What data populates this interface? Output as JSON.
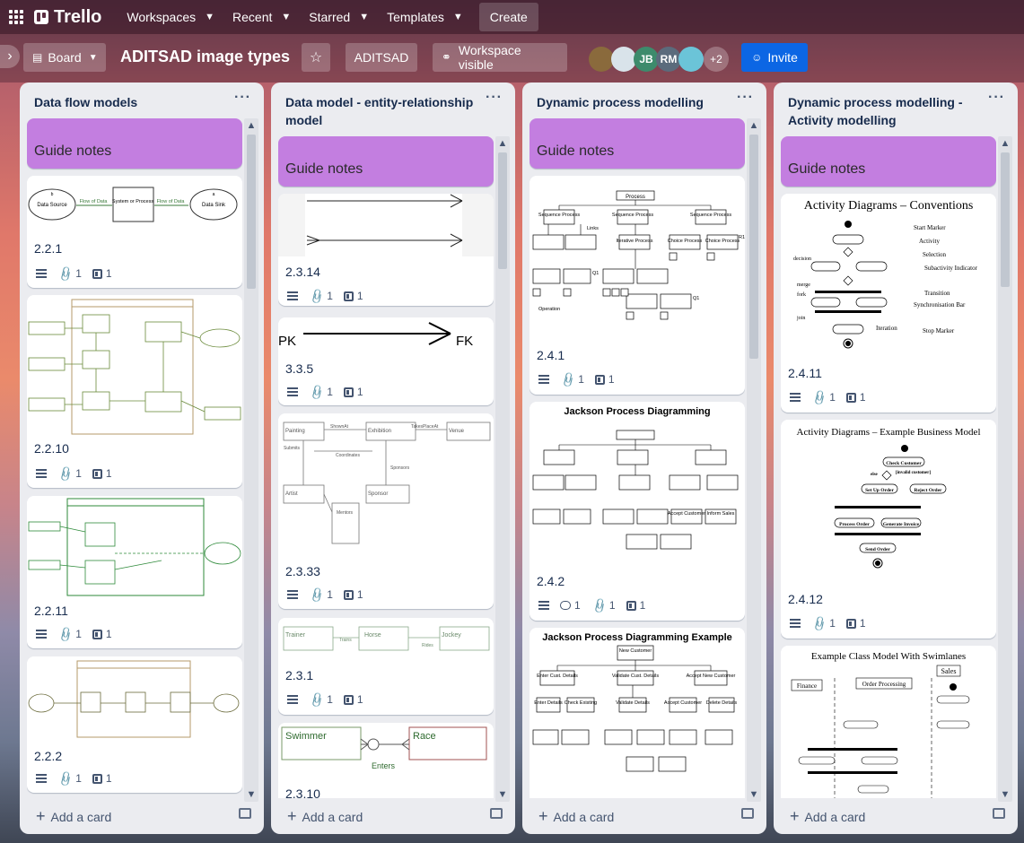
{
  "topbar": {
    "app_name": "Trello",
    "nav": [
      "Workspaces",
      "Recent",
      "Starred",
      "Templates"
    ],
    "create": "Create"
  },
  "board": {
    "view": "Board",
    "title": "ADITSAD image types",
    "workspace": "ADITSAD",
    "visibility": "Workspace visible",
    "avatars": [
      "JB",
      "RM"
    ],
    "more_members": "+2",
    "invite": "Invite"
  },
  "lists": [
    {
      "title": "Data flow models",
      "guide": "Guide notes",
      "cards": [
        {
          "title": "2.2.1",
          "attachments": "1",
          "checklist": "1"
        },
        {
          "title": "2.2.10",
          "attachments": "1",
          "checklist": "1"
        },
        {
          "title": "2.2.11",
          "attachments": "1",
          "checklist": "1"
        },
        {
          "title": "2.2.2",
          "attachments": "1",
          "checklist": "1"
        }
      ],
      "add_card": "Add a card"
    },
    {
      "title": "Data model - entity-relationship model",
      "guide": "Guide notes",
      "cards": [
        {
          "title": "2.3.14",
          "attachments": "1",
          "checklist": "1"
        },
        {
          "title": "3.3.5",
          "attachments": "1",
          "checklist": "1"
        },
        {
          "title": "2.3.33",
          "attachments": "1",
          "checklist": "1"
        },
        {
          "title": "2.3.1",
          "attachments": "1",
          "checklist": "1"
        },
        {
          "title": "2.3.10"
        }
      ],
      "add_card": "Add a card"
    },
    {
      "title": "Dynamic process modelling",
      "guide": "Guide notes",
      "cards": [
        {
          "title": "2.4.1",
          "attachments": "1",
          "checklist": "1"
        },
        {
          "title": "2.4.2",
          "comments": "1",
          "attachments": "1",
          "checklist": "1"
        },
        {
          "title": ""
        }
      ],
      "add_card": "Add a card"
    },
    {
      "title": "Dynamic process modelling - Activity modelling",
      "guide": "Guide notes",
      "cards": [
        {
          "title": "2.4.11",
          "attachments": "1",
          "checklist": "1"
        },
        {
          "title": "2.4.12",
          "attachments": "1",
          "checklist": "1"
        },
        {
          "title": ""
        }
      ],
      "add_card": "Add a card"
    }
  ],
  "covers": {
    "dfd1": {
      "source": "Data Source",
      "flow1": "Flow of Data",
      "process": "System or Process",
      "flow2": "Flow of Data",
      "sink": "Data Sink",
      "b": "b",
      "a": "a"
    },
    "er_pkfk": {
      "pk": "PK",
      "fk": "FK"
    },
    "er_painting": {
      "painting": "Painting",
      "shownat": "ShownAt",
      "exhibition": "Exhibition",
      "takesplaceat": "TakesPlaceAt",
      "venue": "Venue",
      "submits": "Submits",
      "coordinates": "Coordinates",
      "sponsors": "Sponsors",
      "artist": "Artist",
      "sponsor": "Sponsor",
      "mentors": "Mentors"
    },
    "er_trainer": {
      "trainer": "Trainer",
      "trains": "Trains",
      "horse": "Horse",
      "rides": "Rides",
      "jockey": "Jockey"
    },
    "er_swimmer": {
      "swimmer": "Swimmer",
      "race": "Race",
      "enters": "Enters"
    },
    "jsp1": {
      "process": "Process",
      "seq": "Sequence Process",
      "links": "Links",
      "iter": "Iterative Process",
      "choice": "Choice Process",
      "operation": "Operation",
      "r1": "R1",
      "q1": "Q1"
    },
    "jsp2": {
      "title": "Jackson Process Diagramming",
      "accept": "Accept Customer",
      "inform": "Inform Sales"
    },
    "jsp3": {
      "title": "Jackson Process Diagramming Example",
      "root": "New Customer",
      "enter": "Enter Cust. Details",
      "validate": "Validate Cust. Details",
      "accept": "Accept New Customer",
      "enterd": "Enter Details",
      "check": "Check Existing",
      "validated": "Validate Details",
      "acceptc": "Accept Customer",
      "delete": "Delete Details"
    },
    "act1": {
      "title": "Activity Diagrams – Conventions",
      "start": "Start Marker",
      "activity": "Activity",
      "selection": "Selection",
      "subactivity": "Subactivity Indicator",
      "transition": "Transition",
      "sync": "Synchronisation Bar",
      "iteration": "Iteration",
      "stop": "Stop Marker",
      "decision": "decision",
      "merge": "merge",
      "fork": "fork",
      "join": "join"
    },
    "act2": {
      "title": "Activity Diagrams – Example Business Model",
      "check": "Check Customer",
      "setup": "Set Up Order",
      "reject": "Reject Order",
      "processo": "Process Order",
      "invoice": "Generate Invoice",
      "send": "Send Order",
      "else": "else",
      "invalid": "[invalid customer]"
    },
    "act3": {
      "title": "Example Class Model With Swimlanes",
      "sales": "Sales",
      "finance": "Finance",
      "orderproc": "Order Processing"
    }
  }
}
